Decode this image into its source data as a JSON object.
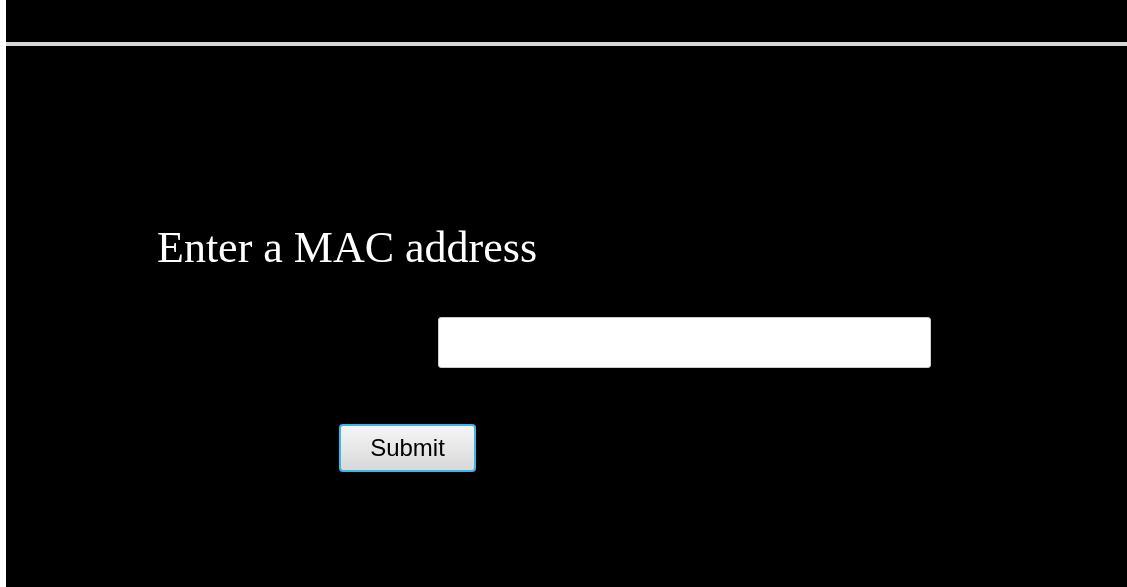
{
  "heading": "Enter a MAC address",
  "mac_field": {
    "kind": "text"
  },
  "submit_button": {
    "label": "Submit"
  }
}
